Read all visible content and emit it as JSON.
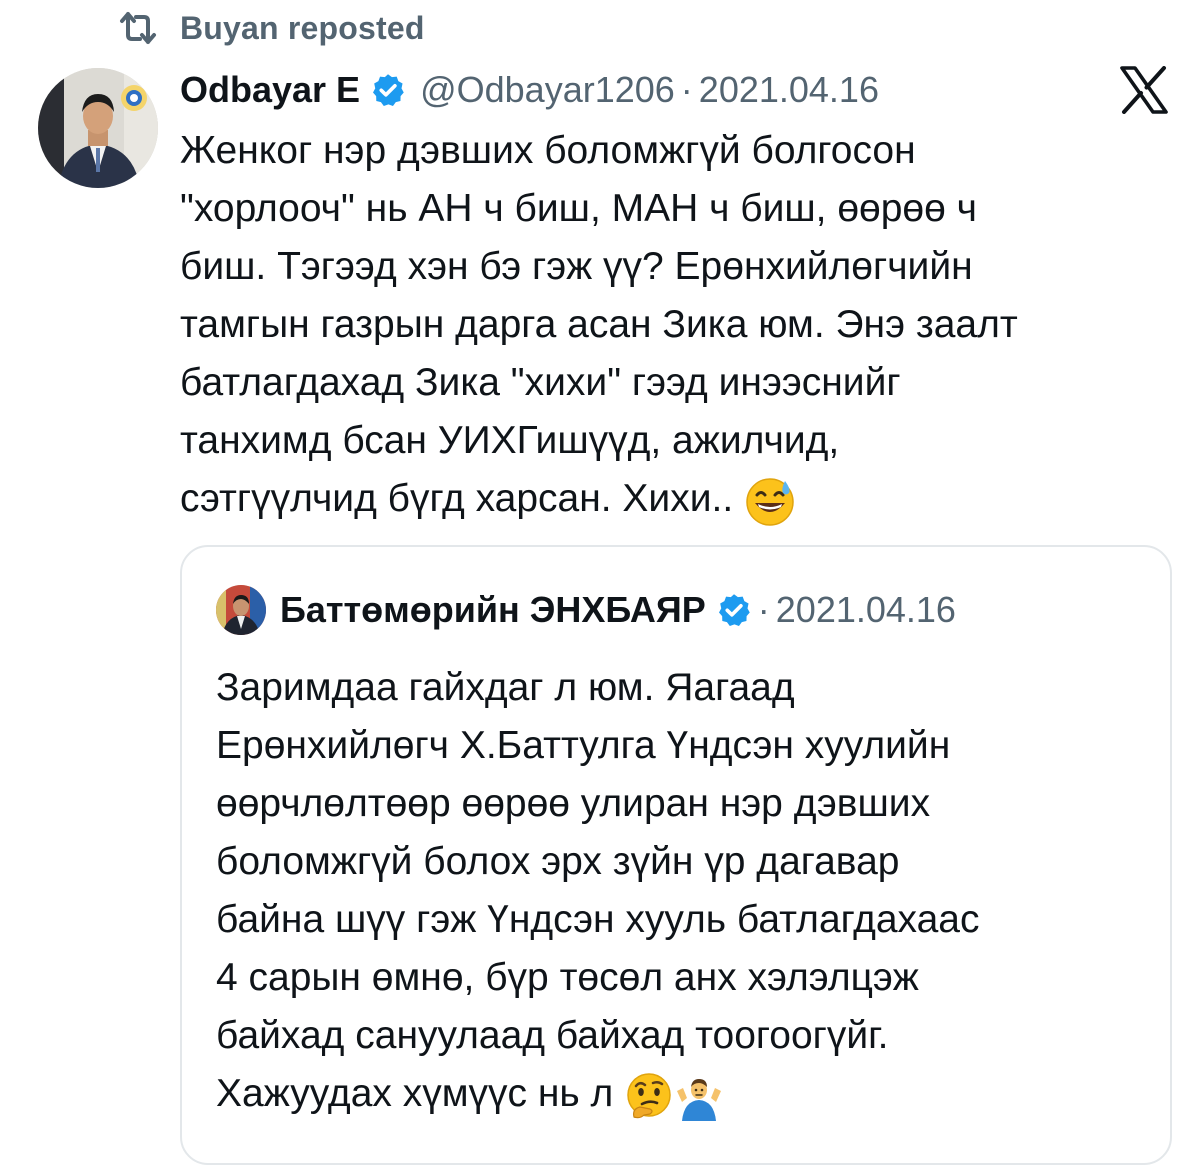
{
  "repost": {
    "label": "Buyan reposted",
    "icon": "repost-icon"
  },
  "tweet": {
    "display_name": "Odbayar E",
    "handle": "@Odbayar1206",
    "separator": "·",
    "date": "2021.04.16",
    "verified_icon": "verified-badge-icon",
    "platform_logo": "x-logo-icon",
    "text": "Женког нэр дэвших боломжгүй болгосон\n\"хорлооч\" нь АН ч биш, МАН ч биш, өөрөө ч\nбиш. Тэгээд хэн бэ гэж үү? Ерөнхийлөгчийн\nтамгын газрын дарга асан Зика юм. Энэ заалт\nбатлагдахад Зика \"хихи\" гээд инээснийг\nтанхимд бсан УИХГишүүд, ажилчид,\nсэтгүүлчид бүгд харсан. Хихи..",
    "emoji": "grinning-sweat-emoji"
  },
  "quote": {
    "display_name": "Баттөмөрийн ЭНХБАЯР",
    "separator": "·",
    "date": "2021.04.16",
    "verified_icon": "verified-badge-icon",
    "text": "Заримдаа гайхдаг л юм. Яагаад\nЕрөнхийлөгч Х.Баттулга Үндсэн хуулийн\nөөрчлөлтөөр өөрөө улиран нэр дэвших\nболомжгүй болох эрх зүйн үр дагавар\nбайна шүү гэж Үндсэн хууль батлагдахаас\n4 сарын өмнө, бүр төсөл анх хэлэлцэж\nбайхад сануулаад байхад тоогоогүйг.\nХажуудах хүмүүс нь л",
    "emojis": [
      "thinking-face-emoji",
      "man-shrugging-emoji"
    ]
  },
  "colors": {
    "text_primary": "#0f1419",
    "text_secondary": "#536471",
    "verified_blue": "#1d9bf0",
    "border": "#e3e7ea"
  }
}
